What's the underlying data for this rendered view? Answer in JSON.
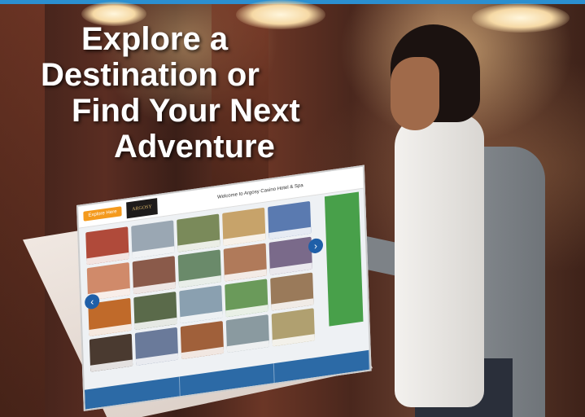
{
  "headline": {
    "line1": "Explore a",
    "line2": "Destination or",
    "line3": "Find Your Next",
    "line4": "Adventure"
  },
  "kiosk": {
    "explore_button": "Explore Here",
    "logo_text": "ARGOSY",
    "welcome_text": "Welcome to Argosy Casino Hotel & Spa",
    "nav_left": "‹",
    "nav_right": "›"
  },
  "colors": {
    "top_bar": "#2b8fd0",
    "explore_button": "#f49a1d",
    "kiosk_sidebar": "#48a04a",
    "kiosk_bottom_bar": "#2c6aa6"
  }
}
